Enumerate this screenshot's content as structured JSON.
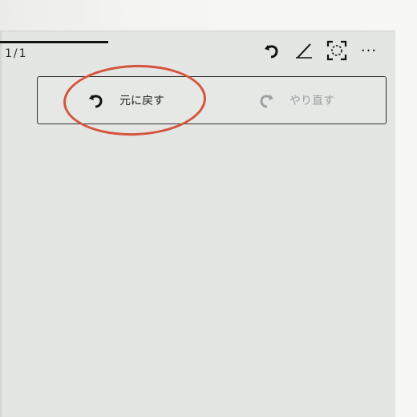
{
  "page": {
    "indicator": "1/1",
    "progress": 0.27
  },
  "toolbar": {
    "icons": [
      "undo-icon",
      "pen-icon",
      "fit-screen-icon",
      "more-icon"
    ],
    "more_label": "···"
  },
  "popup": {
    "undo_label": "元に戻す",
    "redo_label": "やり直す"
  },
  "colors": {
    "screen": "#e4e6e3",
    "highlight": "#d4553e",
    "disabled_text": "#9a9fa0"
  }
}
